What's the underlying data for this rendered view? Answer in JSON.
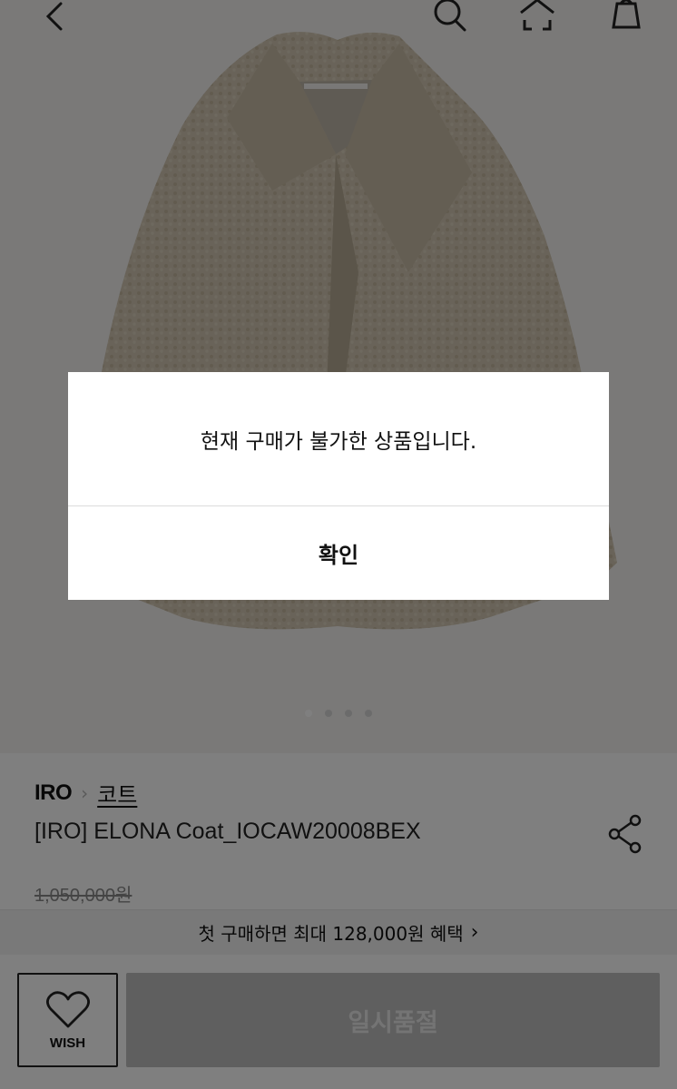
{
  "icons": {
    "back": "chevron-left-icon",
    "search": "search-icon",
    "home": "home-icon",
    "bag": "shopping-bag-icon",
    "share": "share-icon",
    "wish": "heart-icon",
    "benefit_arrow": "chevron-right-icon"
  },
  "carousel": {
    "total": 4,
    "active_index": 0
  },
  "product": {
    "brand": "IRO",
    "category": "코트",
    "title": "[IRO] ELONA Coat_IOCAW20008BEX",
    "original_price": "1,050,000원"
  },
  "benefit": {
    "text": "첫 구매하면 최대 128,000원 혜택",
    "arrow": "›"
  },
  "actions": {
    "wish_label": "WISH",
    "soldout_label": "일시품절"
  },
  "modal": {
    "message": "현재 구매가 불가한 상품입니다.",
    "confirm_label": "확인"
  },
  "colors": {
    "dim_overlay": "rgba(0,0,0,0.5)",
    "coat": "#cfc3ad",
    "soldout_button": "#bfbfbf"
  }
}
